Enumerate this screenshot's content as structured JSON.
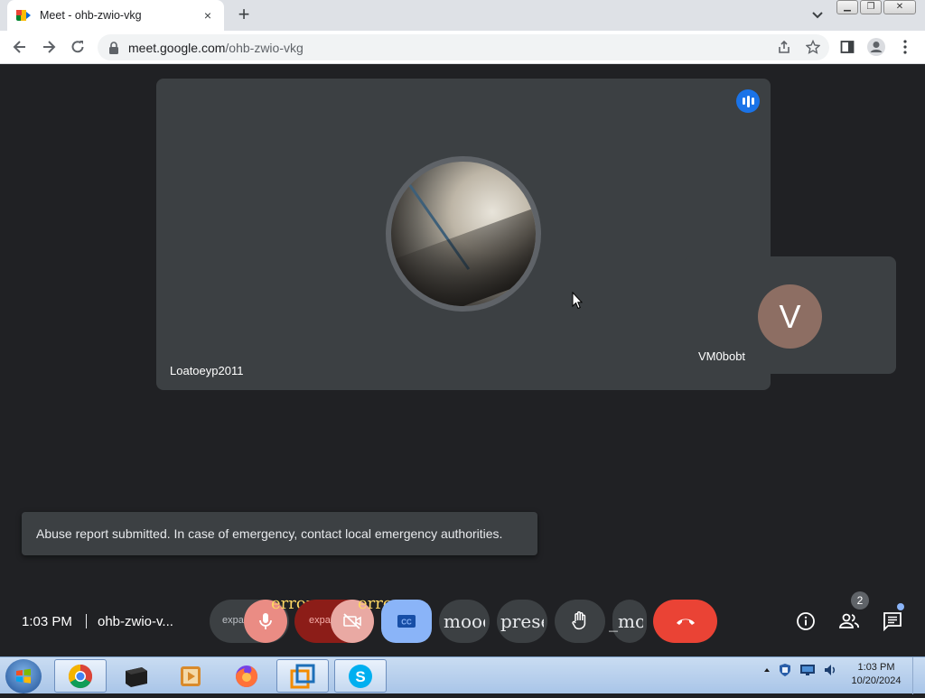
{
  "browser": {
    "tab_title": "Meet - ohb-zwio-vkg",
    "tab_close": "×",
    "new_tab": "+",
    "url_host": "meet.google.com",
    "url_path": "/ohb-zwio-vkg"
  },
  "meeting": {
    "main_participant": "Loatoeyp2011",
    "side_participant": "VM0bobt",
    "side_initial": "V",
    "snackbar": "Abuse report submitted. In case of emergency, contact local emergency authorities.",
    "time": "1:03 PM",
    "code": "ohb-zwio-v...",
    "participants_count": "2",
    "controls": {
      "mic_error": "error",
      "cam_error": "error",
      "mic_expand": "expand_less",
      "cam_expand": "expand_less",
      "mood": "mood",
      "present": "present_to_all",
      "more": "more_vert",
      "more_prefix": "_"
    }
  },
  "taskbar": {
    "time": "1:03 PM",
    "date": "10/20/2024"
  },
  "colors": {
    "meet_bg": "#202124",
    "tile_bg": "#3c4043",
    "accent_blue": "#1a73e8",
    "end_call_red": "#ea4335",
    "cc_blue": "#8ab4f8"
  }
}
